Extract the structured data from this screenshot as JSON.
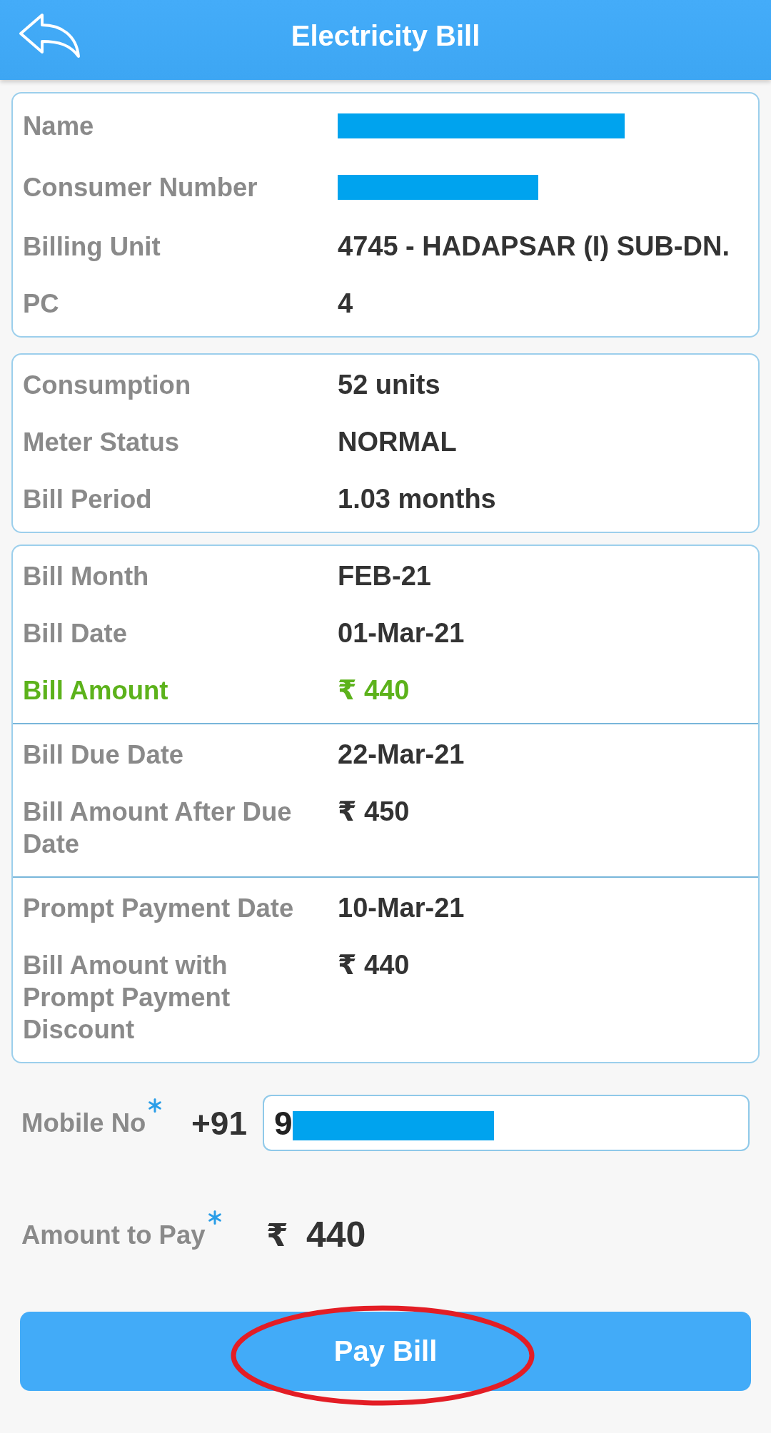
{
  "header": {
    "title": "Electricity Bill"
  },
  "cards": [
    {
      "sections": [
        {
          "rows": [
            {
              "kind": "redacted",
              "label": "Name"
            },
            {
              "kind": "redacted",
              "label": "Consumer Number"
            },
            {
              "kind": "text",
              "label": "Billing Unit",
              "value": "4745 - HADAPSAR (I) SUB-DN."
            },
            {
              "kind": "text",
              "label": "PC",
              "value": "4"
            }
          ]
        }
      ]
    },
    {
      "sections": [
        {
          "rows": [
            {
              "kind": "text",
              "label": "Consumption",
              "value": "52 units"
            },
            {
              "kind": "text",
              "label": "Meter Status",
              "value": "NORMAL"
            },
            {
              "kind": "text",
              "label": "Bill Period",
              "value": "1.03 months"
            }
          ]
        }
      ]
    },
    {
      "sections": [
        {
          "rows": [
            {
              "kind": "text",
              "label": "Bill Month",
              "value": "FEB-21"
            },
            {
              "kind": "text",
              "label": "Bill Date",
              "value": "01-Mar-21"
            },
            {
              "kind": "emphasis",
              "label": "Bill Amount",
              "value": "₹ 440"
            }
          ]
        },
        {
          "rows": [
            {
              "kind": "text",
              "label": "Bill Due Date",
              "value": "22-Mar-21"
            },
            {
              "kind": "text",
              "label": "Bill Amount After Due Date",
              "value": "₹ 450"
            }
          ]
        },
        {
          "rows": [
            {
              "kind": "text",
              "label": "Prompt Payment Date",
              "value": "10-Mar-21"
            },
            {
              "kind": "text",
              "label": "Bill Amount with Prompt Payment Discount",
              "value": "₹ 440"
            }
          ]
        }
      ]
    }
  ],
  "mobile": {
    "label": "Mobile No",
    "required": true,
    "prefix": "+91",
    "value": "9",
    "redacted": true
  },
  "amount_to_pay": {
    "label": "Amount to Pay",
    "required": true,
    "currency": "₹",
    "amount": "440"
  },
  "pay_button": {
    "label": "Pay Bill",
    "circled": true
  }
}
